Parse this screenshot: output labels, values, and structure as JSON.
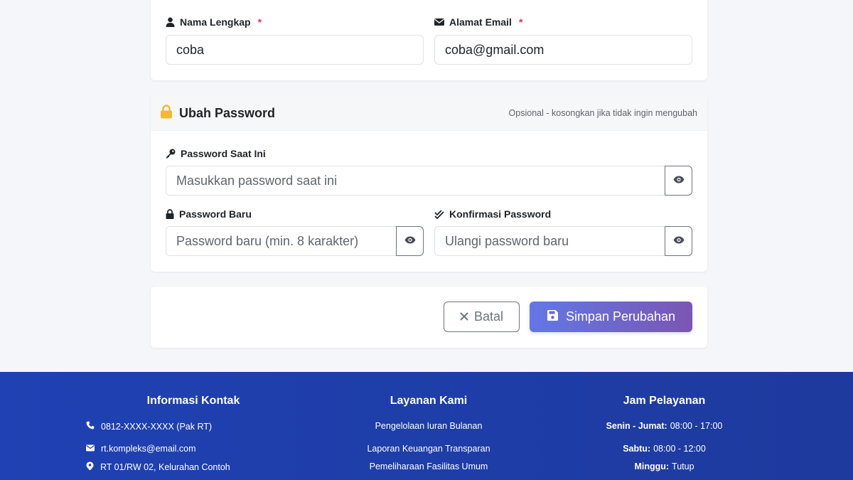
{
  "profile": {
    "name_label": "Nama Lengkap",
    "name_required": "*",
    "name_value": "coba",
    "email_label": "Alamat Email",
    "email_required": "*",
    "email_value": "coba@gmail.com"
  },
  "password_section": {
    "title": "Ubah Password",
    "note": "Opsional - kosongkan jika tidak ingin mengubah",
    "current_label": "Password Saat Ini",
    "current_placeholder": "Masukkan password saat ini",
    "new_label": "Password Baru",
    "new_placeholder": "Password baru (min. 8 karakter)",
    "confirm_label": "Konfirmasi Password",
    "confirm_placeholder": "Ulangi password baru"
  },
  "actions": {
    "cancel_label": "Batal",
    "save_label": "Simpan Perubahan"
  },
  "footer": {
    "contact": {
      "title": "Informasi Kontak",
      "phone": "0812-XXXX-XXXX (Pak RT)",
      "email": "rt.kompleks@email.com",
      "address": "RT 01/RW 02, Kelurahan Contoh"
    },
    "services": {
      "title": "Layanan Kami",
      "items": [
        "Pengelolaan Iuran Bulanan",
        "Laporan Keuangan Transparan",
        "Pemeliharaan Fasilitas Umum"
      ]
    },
    "hours": {
      "title": "Jam Pelayanan",
      "rows": [
        {
          "day": "Senin - Jumat:",
          "time": "08:00 - 17:00"
        },
        {
          "day": "Sabtu:",
          "time": "08:00 - 12:00"
        },
        {
          "day": "Minggu:",
          "time": "Tutup"
        }
      ]
    }
  },
  "colors": {
    "accent_gradient_start": "#6178e6",
    "accent_gradient_end": "#7b56b3",
    "footer_bg": "#1f41b3",
    "required": "#dc3545",
    "lock_icon": "#f5b82e"
  },
  "icons": [
    "user-icon",
    "envelope-icon",
    "lock-icon",
    "key-icon",
    "check-double-icon",
    "eye-icon",
    "times-icon",
    "save-icon",
    "phone-icon",
    "map-marker-icon"
  ]
}
